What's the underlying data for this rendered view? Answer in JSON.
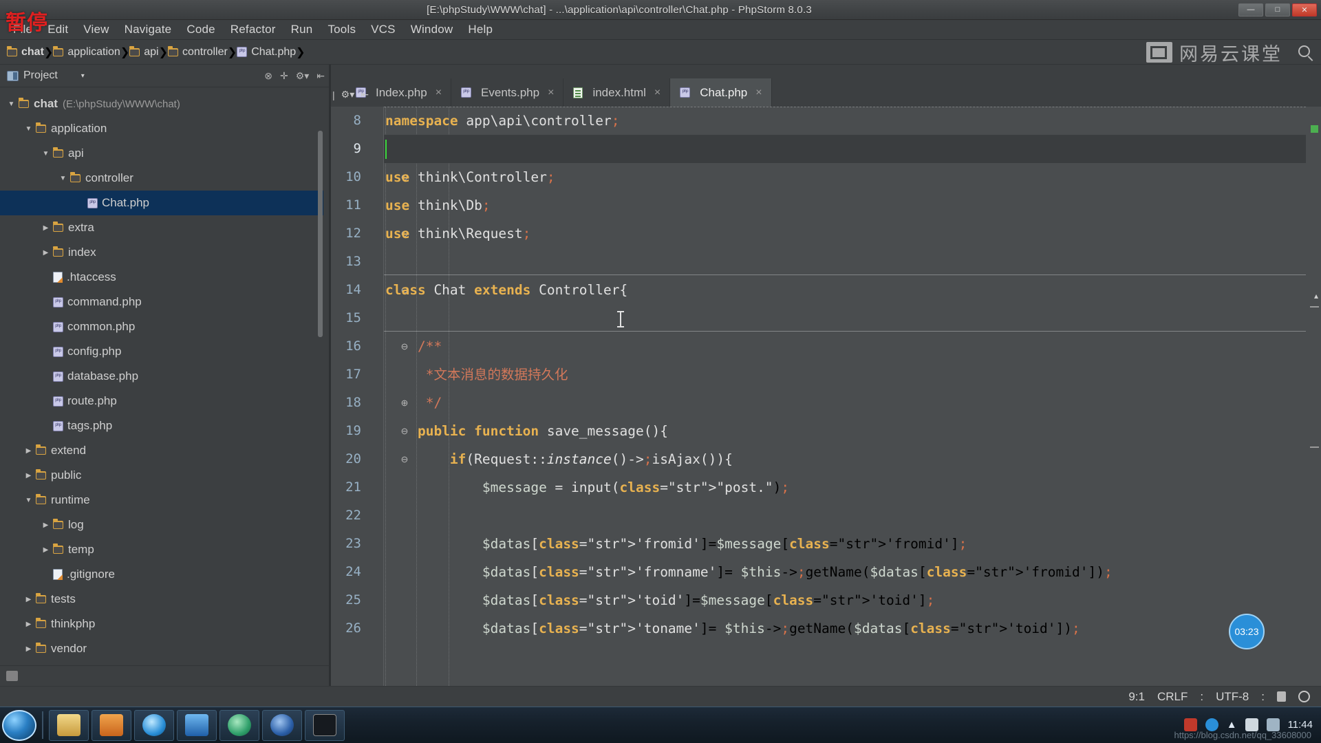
{
  "window": {
    "title": "[E:\\phpStudy\\WWW\\chat] - ...\\application\\api\\controller\\Chat.php - PhpStorm 8.0.3",
    "pause_overlay": "暂停",
    "buttons": {
      "minimize": "—",
      "maximize": "□",
      "close": "✕"
    }
  },
  "menu": [
    {
      "label": "File"
    },
    {
      "label": "Edit"
    },
    {
      "label": "View"
    },
    {
      "label": "Navigate"
    },
    {
      "label": "Code"
    },
    {
      "label": "Refactor"
    },
    {
      "label": "Run"
    },
    {
      "label": "Tools"
    },
    {
      "label": "VCS"
    },
    {
      "label": "Window"
    },
    {
      "label": "Help"
    }
  ],
  "breadcrumb": [
    {
      "label": "chat",
      "icon": "folder-icon"
    },
    {
      "label": "application",
      "icon": "folder-icon"
    },
    {
      "label": "api",
      "icon": "folder-icon"
    },
    {
      "label": "controller",
      "icon": "folder-icon"
    },
    {
      "label": "Chat.php",
      "icon": "php-file-icon"
    }
  ],
  "brand": {
    "text": "网易云课堂"
  },
  "tool_window": {
    "title": "Project",
    "caret": "▾",
    "actions": [
      "collapse-all-icon",
      "locate-icon",
      "settings-icon",
      "hide-icon"
    ]
  },
  "tree": [
    {
      "indent": 0,
      "twisty": "▼",
      "icon": "folder",
      "label": "chat",
      "path": "(E:\\phpStudy\\WWW\\chat)",
      "bold": true,
      "selected": false
    },
    {
      "indent": 1,
      "twisty": "▼",
      "icon": "folder",
      "label": "application",
      "path": "",
      "bold": false,
      "selected": false
    },
    {
      "indent": 2,
      "twisty": "▼",
      "icon": "folder",
      "label": "api",
      "path": "",
      "bold": false,
      "selected": false
    },
    {
      "indent": 3,
      "twisty": "▼",
      "icon": "folder",
      "label": "controller",
      "path": "",
      "bold": false,
      "selected": false
    },
    {
      "indent": 4,
      "twisty": "",
      "icon": "php",
      "label": "Chat.php",
      "path": "",
      "bold": false,
      "selected": true
    },
    {
      "indent": 2,
      "twisty": "▶",
      "icon": "folder",
      "label": "extra",
      "path": "",
      "bold": false,
      "selected": false
    },
    {
      "indent": 2,
      "twisty": "▶",
      "icon": "folder",
      "label": "index",
      "path": "",
      "bold": false,
      "selected": false
    },
    {
      "indent": 2,
      "twisty": "",
      "icon": "htaccess",
      "label": ".htaccess",
      "path": "",
      "bold": false,
      "selected": false
    },
    {
      "indent": 2,
      "twisty": "",
      "icon": "php",
      "label": "command.php",
      "path": "",
      "bold": false,
      "selected": false
    },
    {
      "indent": 2,
      "twisty": "",
      "icon": "php",
      "label": "common.php",
      "path": "",
      "bold": false,
      "selected": false
    },
    {
      "indent": 2,
      "twisty": "",
      "icon": "php",
      "label": "config.php",
      "path": "",
      "bold": false,
      "selected": false
    },
    {
      "indent": 2,
      "twisty": "",
      "icon": "php",
      "label": "database.php",
      "path": "",
      "bold": false,
      "selected": false
    },
    {
      "indent": 2,
      "twisty": "",
      "icon": "php",
      "label": "route.php",
      "path": "",
      "bold": false,
      "selected": false
    },
    {
      "indent": 2,
      "twisty": "",
      "icon": "php",
      "label": "tags.php",
      "path": "",
      "bold": false,
      "selected": false
    },
    {
      "indent": 1,
      "twisty": "▶",
      "icon": "folder",
      "label": "extend",
      "path": "",
      "bold": false,
      "selected": false
    },
    {
      "indent": 1,
      "twisty": "▶",
      "icon": "folder",
      "label": "public",
      "path": "",
      "bold": false,
      "selected": false
    },
    {
      "indent": 1,
      "twisty": "▼",
      "icon": "folder",
      "label": "runtime",
      "path": "",
      "bold": false,
      "selected": false
    },
    {
      "indent": 2,
      "twisty": "▶",
      "icon": "folder",
      "label": "log",
      "path": "",
      "bold": false,
      "selected": false
    },
    {
      "indent": 2,
      "twisty": "▶",
      "icon": "folder",
      "label": "temp",
      "path": "",
      "bold": false,
      "selected": false
    },
    {
      "indent": 2,
      "twisty": "",
      "icon": "htaccess",
      "label": ".gitignore",
      "path": "",
      "bold": false,
      "selected": false
    },
    {
      "indent": 1,
      "twisty": "▶",
      "icon": "folder",
      "label": "tests",
      "path": "",
      "bold": false,
      "selected": false
    },
    {
      "indent": 1,
      "twisty": "▶",
      "icon": "folder",
      "label": "thinkphp",
      "path": "",
      "bold": false,
      "selected": false
    },
    {
      "indent": 1,
      "twisty": "▶",
      "icon": "folder",
      "label": "vendor",
      "path": "",
      "bold": false,
      "selected": false
    }
  ],
  "tabs": [
    {
      "label": "Index.php",
      "icon": "php-file-icon",
      "active": false,
      "closable": true
    },
    {
      "label": "Events.php",
      "icon": "php-file-icon",
      "active": false,
      "closable": true
    },
    {
      "label": "index.html",
      "icon": "html-file-icon",
      "active": false,
      "closable": true
    },
    {
      "label": "Chat.php",
      "icon": "php-file-icon",
      "active": true,
      "closable": true
    }
  ],
  "code": {
    "first_visible_line": 8,
    "current_line": 9,
    "lines": [
      {
        "n": 8,
        "fold": "",
        "text": "namespace app\\api\\controller;"
      },
      {
        "n": 9,
        "fold": "",
        "text": ""
      },
      {
        "n": 10,
        "fold": "⊖",
        "text": "use think\\Controller;"
      },
      {
        "n": 11,
        "fold": "",
        "text": "use think\\Db;"
      },
      {
        "n": 12,
        "fold": "⊖",
        "text": "use think\\Request;"
      },
      {
        "n": 13,
        "fold": "",
        "text": ""
      },
      {
        "n": 14,
        "fold": "⊖",
        "text": "class Chat extends Controller{"
      },
      {
        "n": 15,
        "fold": "",
        "text": ""
      },
      {
        "n": 16,
        "fold": "⊖",
        "text": "    /**"
      },
      {
        "n": 17,
        "fold": "",
        "text": "     *文本消息的数据持久化"
      },
      {
        "n": 18,
        "fold": "⊕",
        "text": "     */"
      },
      {
        "n": 19,
        "fold": "⊖",
        "text": "    public function save_message(){"
      },
      {
        "n": 20,
        "fold": "⊖",
        "text": "        if(Request::instance()->isAjax()){"
      },
      {
        "n": 21,
        "fold": "",
        "text": "            $message = input(\"post.\");"
      },
      {
        "n": 22,
        "fold": "",
        "text": ""
      },
      {
        "n": 23,
        "fold": "",
        "text": "            $datas['fromid']=$message['fromid'];"
      },
      {
        "n": 24,
        "fold": "",
        "text": "            $datas['fromname']= $this->getName($datas['fromid']);"
      },
      {
        "n": 25,
        "fold": "",
        "text": "            $datas['toid']=$message['toid'];"
      },
      {
        "n": 26,
        "fold": "",
        "text": "            $datas['toname']= $this->getName($datas['toid']);"
      }
    ]
  },
  "recording": {
    "timer": "03:23"
  },
  "status_bar": {
    "caret_position": "9:1",
    "line_separator": "CRLF",
    "encoding_separator": ":",
    "encoding": "UTF-8",
    "trailing_separator": ":"
  },
  "taskbar": {
    "start": "start-orb",
    "apps": [
      {
        "name": "explorer-icon",
        "color": "#d8c07a"
      },
      {
        "name": "phpstudy-icon",
        "color": "#e08a30"
      },
      {
        "name": "internet-explorer-icon",
        "color": "#3aa0e0"
      },
      {
        "name": "wechat-icon",
        "color": "#2f7fd0"
      },
      {
        "name": "phpstorm-icon",
        "color": "#3aa06a"
      },
      {
        "name": "firefox-icon",
        "color": "#2b5fa8"
      },
      {
        "name": "console-icon",
        "color": "#20242a"
      }
    ],
    "tray": {
      "time": "11:44",
      "date": ""
    },
    "watermark": "https://blog.csdn.net/qq_33608000"
  }
}
